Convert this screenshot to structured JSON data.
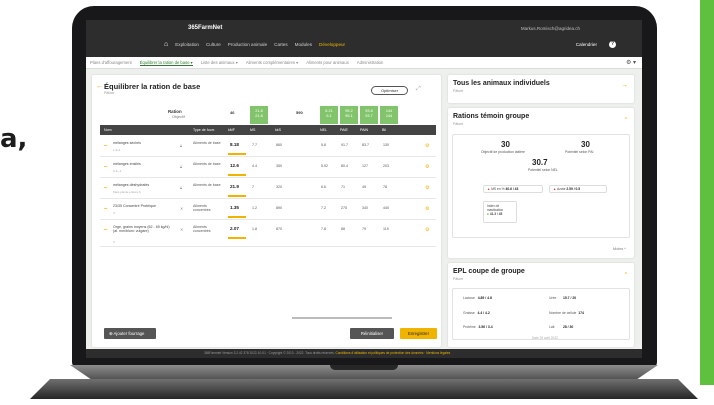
{
  "page": {
    "headline_fragment": "a,"
  },
  "app": {
    "brand": "365FarmNet",
    "user_email": "Markus.Romisch@agridea.ch",
    "nav": [
      "Exploitation",
      "Culture",
      "Production animale",
      "Cartes",
      "Modules",
      "Développeur"
    ],
    "nav_active": "Développeur",
    "calendar": "Calendrier",
    "help": "?"
  },
  "subnav": {
    "items": [
      "Plans d'affouragement",
      "Équilibrer la ration de base ▾",
      "Liste des animaux ▾",
      "Aliments complémentaires ▾",
      "Aliments pour animaux",
      "Administration"
    ],
    "active_index": 1,
    "gear": "⚙ ▾"
  },
  "main": {
    "title": "Équilibrer la ration de base",
    "subtitle": "Pâtoer",
    "optimize_label": "Optimiser",
    "ration_label": "Ration",
    "objectif_label": "Objectif",
    "header_values": {
      "ms": "46",
      "nel_top": "21.8",
      "nel_bottom": "21.8",
      "ms_col": "590",
      "c1_top": "6.21",
      "c1_bottom": "6.1",
      "c2_top": "95.2",
      "c2_bottom": "95.1",
      "c3_top": "93.8",
      "c3_bottom": "93.7",
      "c4_top": "144",
      "c4_bottom": "144"
    },
    "columns": [
      "Nom",
      "Type de fourr.",
      "kMF",
      "MS",
      "kkS",
      "NEL",
      "PAIE",
      "PAIN",
      "Bil"
    ],
    "rows": [
      {
        "name": "mélanges séchés",
        "sub": "1.3+1",
        "type": "Aliments de base",
        "qty": "8.18",
        "v1": "7.7",
        "v2": "860",
        "v3": "5.8",
        "v4": "91.7",
        "v5": "83.7",
        "v6": "130"
      },
      {
        "name": "mélanges ensilés",
        "sub": "0.3+-1",
        "type": "Aliments de base",
        "qty": "12.6",
        "v1": "4.4",
        "v2": "350",
        "v3": "5.92",
        "v4": "80.4",
        "v5": "127",
        "v6": "203"
      },
      {
        "name": "mélanges déshydratés",
        "sub": "Mais plante entière 6",
        "type": "Aliments de base",
        "qty": "21.9",
        "v1": "7",
        "v2": "320",
        "v3": "6.6",
        "v4": "71",
        "v5": "49",
        "v6": "78"
      },
      {
        "name": "23/35 Concentré Protéique",
        "sub": "3",
        "type": "Aliments concentrés",
        "qty": "1.35",
        "v1": "1.2",
        "v2": "890",
        "v3": "7.2",
        "v4": "275",
        "v5": "340",
        "v6": "440"
      },
      {
        "name": "Orge, grains moyens (62 - 69 kg/hl) (al. mm/blum: vulgare)",
        "sub": "3",
        "type": "Aliments concentrés",
        "qty": "2.07",
        "v1": "1.8",
        "v2": "870",
        "v3": "7.8",
        "v4": "88",
        "v5": "79",
        "v6": "119"
      }
    ],
    "add_label": "⊕ Ajouter fourrage",
    "reset_label": "Réinitialiser",
    "save_label": "Enregistrer"
  },
  "animals_card": {
    "title": "Tous les animaux individuels",
    "subtitle": "Pâtoer"
  },
  "rations_card": {
    "title": "Rations témoin groupe",
    "subtitle": "Pâtoer",
    "kpi1_value": "30",
    "kpi1_label": "Objectif de production laitière",
    "kpi2_value": "30",
    "kpi2_label": "Potentiel selon PAI",
    "kpi3_value": "30.7",
    "kpi3_label": "Potentiel selon NEL",
    "tag1": "MS en %",
    "tag1_val": "40.6 / 43",
    "tag2": "Azote",
    "tag2_val": "2.59 / 0.5",
    "index_label": "Index de mastication",
    "index_val": "41.3 / 45",
    "more": "Moins ^"
  },
  "epl_card": {
    "title": "EPL coupe de groupe",
    "subtitle": "Pâtoer",
    "cells": [
      {
        "label": "Lactose",
        "value": "4.89 / 4.8"
      },
      {
        "label": "Urée",
        "value": "15.7 / 20"
      },
      {
        "label": "Graisse",
        "value": "4.4 / 4.2"
      },
      {
        "label": "Nombre de cellule",
        "value": "174"
      },
      {
        "label": "Protéine",
        "value": "3.56 / 3.4"
      },
      {
        "label": "Lait",
        "value": "28 / 30"
      }
    ],
    "date": "Date 29 avril 2022"
  },
  "footer": {
    "text": "365Farmnet Version 3.2.42 378 2022-10-01 · Copyright © 2013 - 2022. Tous droits réservés.",
    "link": "Conditions d'utilisation et politiques de protection des données · Mentions légales"
  }
}
